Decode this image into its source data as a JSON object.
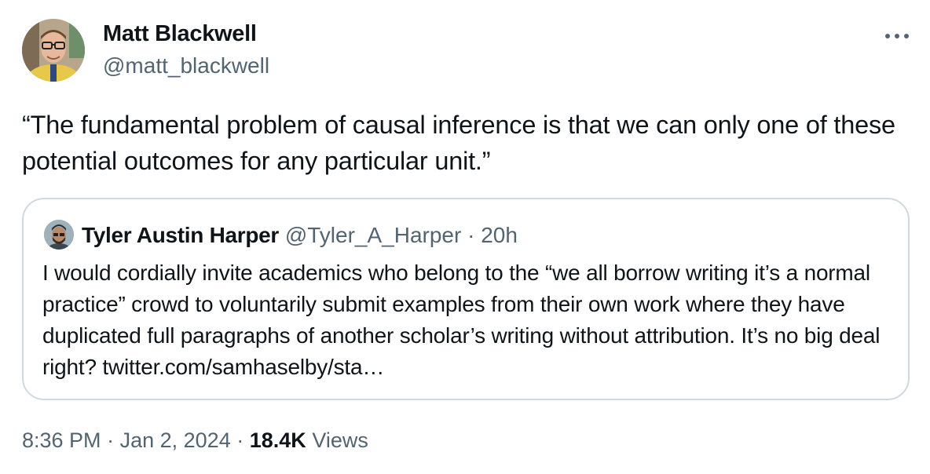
{
  "author": {
    "name": "Matt Blackwell",
    "handle": "@matt_blackwell"
  },
  "more_icon": "more-horizontal-icon",
  "tweet_text": "“The fundamental problem of causal inference is that we can only one of these potential outcomes for any particular unit.”",
  "quoted_tweet": {
    "name": "Tyler Austin Harper",
    "handle": "@Tyler_A_Harper",
    "separator": "·",
    "time": "20h",
    "text": "I would cordially invite academics who belong to the “we all borrow writing it’s a normal practice” crowd to voluntarily submit examples from their own work where they have duplicated full paragraphs of another scholar’s writing without attribution. It’s no big deal right? twitter.com/samhaselby/sta…"
  },
  "footer": {
    "time": "8:36 PM",
    "separator1": "·",
    "date": "Jan 2, 2024",
    "separator2": "·",
    "views_count": "18.4K",
    "views_label": "Views"
  },
  "colors": {
    "text_primary": "#0f1419",
    "text_secondary": "#536471",
    "border": "#cfd9de",
    "avatar_jacket": "#e8c84a"
  }
}
